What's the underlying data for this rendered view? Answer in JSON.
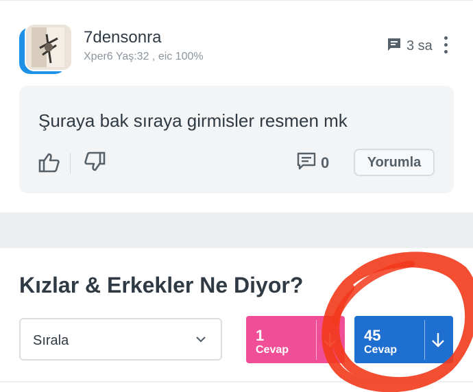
{
  "post": {
    "username": "7densonra",
    "meta": "Xper6 Yaş:32 , eic 100%",
    "time": "3 sa",
    "message": "Şuraya bak sıraya girmisler resmen mk",
    "comment_count": "0",
    "reply_label": "Yorumla"
  },
  "section": {
    "title": "Kızlar & Erkekler Ne Diyor?",
    "sort_label": "Sırala",
    "girls": {
      "count": "1",
      "label": "Cevap",
      "color": "#f04f97"
    },
    "boys": {
      "count": "45",
      "label": "Cevap",
      "color": "#1f6fd0"
    }
  },
  "icons": [
    "comment-icon",
    "more-vertical-icon",
    "thumbs-up-icon",
    "thumbs-down-icon",
    "chevron-down-icon",
    "arrow-down-icon"
  ],
  "colors": {
    "accent": "#1e90e6",
    "annotation": "#f23a1c"
  }
}
